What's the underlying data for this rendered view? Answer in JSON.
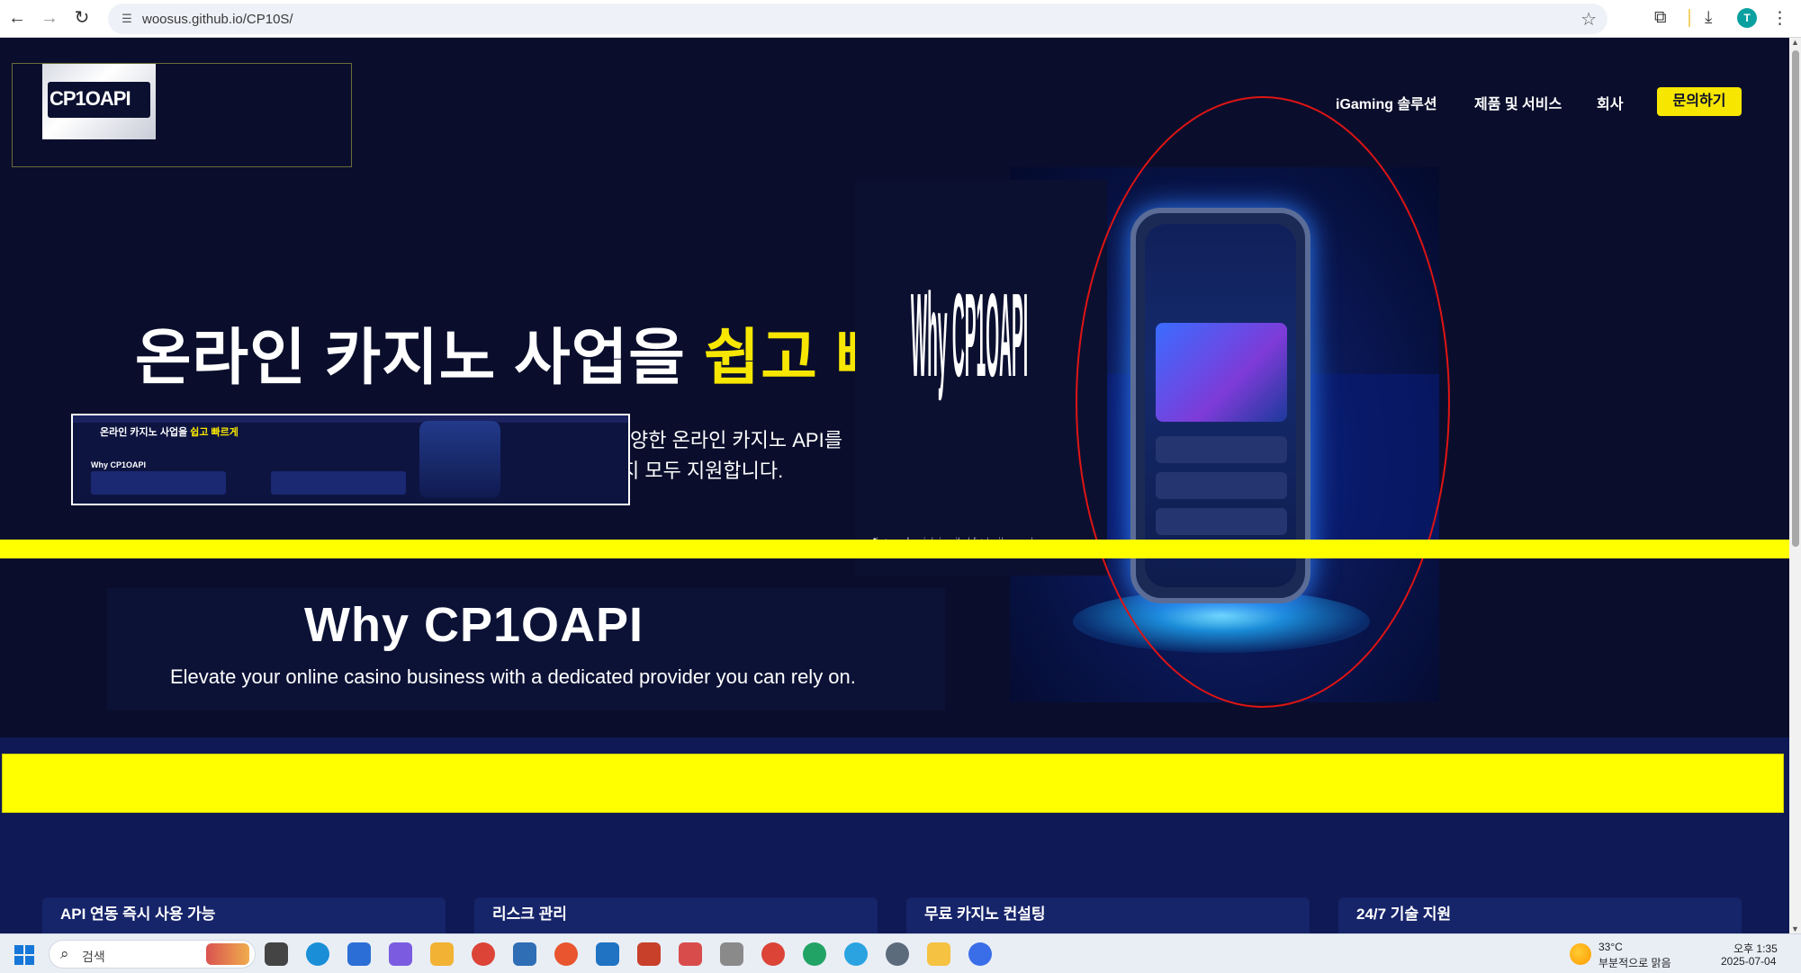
{
  "browser": {
    "url": "woosus.github.io/CP10S/",
    "profile_initial": "T"
  },
  "site": {
    "logo_text": "CP1OAPI",
    "nav": [
      "iGaming 솔루션",
      "제품 및 서비스",
      "회사"
    ],
    "cta": "문의하기",
    "hero": {
      "title_white": "온라인 카지노 사업을 ",
      "title_highlight": "쉽고 빠",
      "desc_line1": "양한 온라인 카지노 API를",
      "desc_line2": "지 모두 지원합니다."
    },
    "embedded_preview": {
      "title_white": "온라인 카지노 사업을 ",
      "title_highlight": "쉽고 빠르게",
      "why": "Why CP1OAPI"
    },
    "panel": {
      "big_text": "Why CP1OAPI",
      "small_text": "Elevate your online casino business with a dedicated provider you can rely on."
    },
    "why": {
      "title": "Why CP1OAPI",
      "subtitle": "Elevate your online casino business with a dedicated provider you can rely on."
    },
    "features": [
      "API 연동 즉시 사용 가능",
      "리스크 관리",
      "무료 카지노 컨설팅",
      "24/7 기술 지원"
    ]
  },
  "taskbar": {
    "search_placeholder": "검색",
    "weather_temp": "33°C",
    "weather_desc": "부분적으로 맑음",
    "time": "오후 1:35",
    "date": "2025-07-04"
  },
  "colors": {
    "page_bg": "#0a0e2c",
    "accent_yellow": "#f7e600",
    "overlay_yellow": "#ffff00",
    "annotation_red": "#e01414"
  }
}
